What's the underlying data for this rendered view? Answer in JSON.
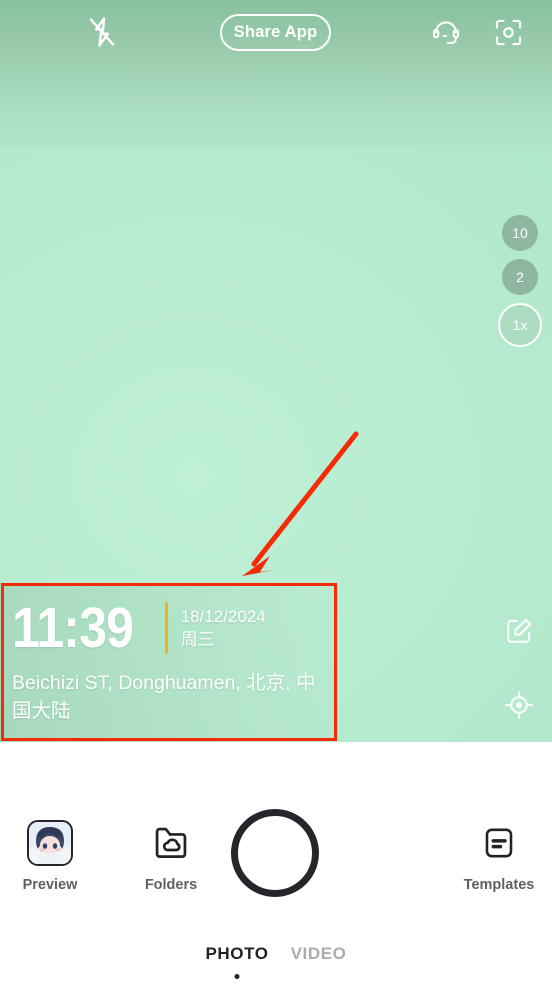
{
  "app": {
    "screen_name": "camera-viewfinder",
    "background_color": "#b9edd1",
    "accent_color": "#f0b429",
    "annotation_color": "#f52a06"
  },
  "topbar": {
    "flash_icon": "flash-off-icon",
    "share_label": "Share App",
    "support_icon": "headset-icon",
    "flip_icon": "camera-flip-icon"
  },
  "zoom": {
    "options": [
      {
        "label": "10",
        "active": false
      },
      {
        "label": "2",
        "active": false
      },
      {
        "label": "1x",
        "active": true
      }
    ]
  },
  "side_tools": [
    {
      "name": "edit-watermark",
      "icon": "edit-square-icon"
    },
    {
      "name": "locate",
      "icon": "location-target-icon"
    }
  ],
  "watermark": {
    "time": "11:39",
    "date": "18/12/2024",
    "weekday": "周三",
    "location": "Beichizi ST, Donghuamen, 北京, 中国大陆",
    "divider_color": "#f0b429"
  },
  "annotation": {
    "type": "red-arrow-and-box",
    "target": "watermark-overlay",
    "color": "#f52a06"
  },
  "bottombar": {
    "preview": {
      "label": "Preview",
      "icon": "avatar-thumbnail"
    },
    "folders": {
      "label": "Folders",
      "icon": "cloud-folder-icon"
    },
    "templates": {
      "label": "Templates",
      "icon": "template-document-icon"
    },
    "shutter": {
      "name": "shutter-button"
    },
    "modes": [
      {
        "label": "PHOTO",
        "active": true
      },
      {
        "label": "VIDEO",
        "active": false
      }
    ]
  }
}
